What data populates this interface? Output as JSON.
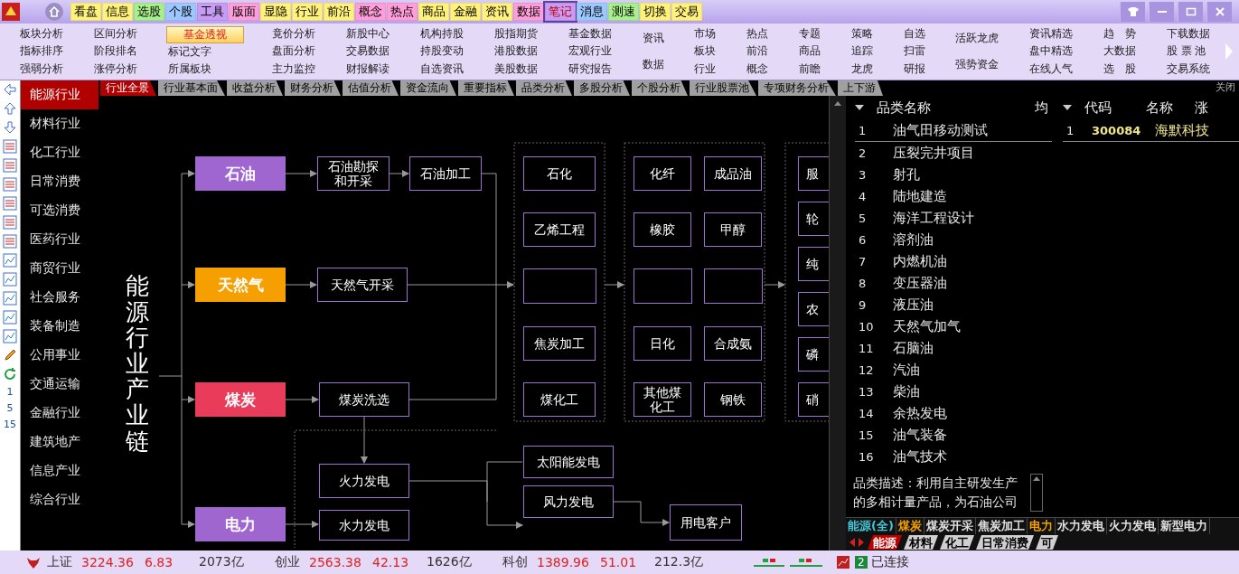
{
  "menu": {
    "items": [
      {
        "label": "看盘",
        "color": "#fff27a",
        "selected": false
      },
      {
        "label": "信息",
        "color": "#fff27a",
        "selected": false
      },
      {
        "label": "选股",
        "color": "#a8f08c",
        "selected": false
      },
      {
        "label": "个股",
        "color": "#9cc8ff",
        "selected": false
      },
      {
        "label": "工具",
        "color": "#c79cf5",
        "selected": false
      },
      {
        "label": "版面",
        "color": "#ff9ed8",
        "selected": false
      },
      {
        "label": "显隐",
        "color": "#fff27a",
        "selected": false
      },
      {
        "label": "行业",
        "color": "#fff27a",
        "selected": false
      },
      {
        "label": "前沿",
        "color": "#fff27a",
        "selected": false
      },
      {
        "label": "概念",
        "color": "#ff9ed8",
        "selected": false
      },
      {
        "label": "热点",
        "color": "#ff9ed8",
        "selected": false
      },
      {
        "label": "商品",
        "color": "#fff27a",
        "selected": false
      },
      {
        "label": "金融",
        "color": "#fff27a",
        "selected": false
      },
      {
        "label": "资讯",
        "color": "#fff27a",
        "selected": false
      },
      {
        "label": "数据",
        "color": "#ff9ed8",
        "selected": false
      },
      {
        "label": "笔记",
        "color": "#c79cf5",
        "selected": true
      },
      {
        "label": "消息",
        "color": "#9cc8ff",
        "selected": false
      },
      {
        "label": "测速",
        "color": "#a8f08c",
        "selected": false
      },
      {
        "label": "切换",
        "color": "#fff27a",
        "selected": false
      },
      {
        "label": "交易",
        "color": "#fff27a",
        "selected": false
      }
    ]
  },
  "submenu": {
    "columns": [
      [
        {
          "label": "板块分析",
          "selected": false
        },
        {
          "label": "指标排序",
          "selected": false
        },
        {
          "label": "强弱分析",
          "selected": false
        }
      ],
      [
        {
          "label": "区间分析",
          "selected": false
        },
        {
          "label": "阶段排名",
          "selected": false
        },
        {
          "label": "涨停分析",
          "selected": false
        }
      ],
      [
        {
          "label": "基金透视",
          "selected": true
        },
        {
          "label": "标记文字",
          "selected": false
        },
        {
          "label": "所属板块",
          "selected": false
        }
      ],
      [
        {
          "label": "竟价分析",
          "selected": false
        },
        {
          "label": "盘面分析",
          "selected": false
        },
        {
          "label": "主力监控",
          "selected": false
        }
      ],
      [
        {
          "label": "新股中心",
          "selected": false
        },
        {
          "label": "交易数据",
          "selected": false
        },
        {
          "label": "财报解读",
          "selected": false
        }
      ],
      [
        {
          "label": "机构持股",
          "selected": false
        },
        {
          "label": "持股变动",
          "selected": false
        },
        {
          "label": "自选资讯",
          "selected": false
        }
      ],
      [
        {
          "label": "股指期货",
          "selected": false
        },
        {
          "label": "港股数据",
          "selected": false
        },
        {
          "label": "美股数据",
          "selected": false
        }
      ],
      [
        {
          "label": "基金数据",
          "selected": false
        },
        {
          "label": "宏观行业",
          "selected": false
        },
        {
          "label": "研究报告",
          "selected": false
        }
      ],
      [
        {
          "label": "资讯",
          "selected": false
        },
        {
          "label": "数据",
          "selected": false
        }
      ],
      [
        {
          "label": "市场",
          "selected": false
        },
        {
          "label": "板块",
          "selected": false
        },
        {
          "label": "行业",
          "selected": false
        }
      ],
      [
        {
          "label": "热点",
          "selected": false
        },
        {
          "label": "前沿",
          "selected": false
        },
        {
          "label": "概念",
          "selected": false
        }
      ],
      [
        {
          "label": "专题",
          "selected": false
        },
        {
          "label": "商品",
          "selected": false
        },
        {
          "label": "前瞻",
          "selected": false
        }
      ],
      [
        {
          "label": "策略",
          "selected": false
        },
        {
          "label": "追踪",
          "selected": false
        },
        {
          "label": "龙虎",
          "selected": false
        }
      ],
      [
        {
          "label": "自选",
          "selected": false
        },
        {
          "label": "扫雷",
          "selected": false
        },
        {
          "label": "研报",
          "selected": false
        }
      ],
      [
        {
          "label": "活跃龙虎",
          "selected": false
        },
        {
          "label": "强势资金",
          "selected": false
        }
      ],
      [
        {
          "label": "资讯精选",
          "selected": false
        },
        {
          "label": "盘中精选",
          "selected": false
        },
        {
          "label": "在线人气",
          "selected": false
        }
      ],
      [
        {
          "label": "趋　势",
          "selected": false
        },
        {
          "label": "大数据",
          "selected": false
        },
        {
          "label": "选　股",
          "selected": false
        }
      ],
      [
        {
          "label": "下载数据",
          "selected": false
        },
        {
          "label": "股 票 池",
          "selected": false
        },
        {
          "label": "交易系统",
          "selected": false
        }
      ]
    ]
  },
  "period_labels": [
    "1",
    "5",
    "15"
  ],
  "sectors": [
    {
      "label": "能源行业",
      "selected": true
    },
    {
      "label": "材料行业",
      "selected": false
    },
    {
      "label": "化工行业",
      "selected": false
    },
    {
      "label": "日常消费",
      "selected": false
    },
    {
      "label": "可选消费",
      "selected": false
    },
    {
      "label": "医药行业",
      "selected": false
    },
    {
      "label": "商贸行业",
      "selected": false
    },
    {
      "label": "社会服务",
      "selected": false
    },
    {
      "label": "装备制造",
      "selected": false
    },
    {
      "label": "公用事业",
      "selected": false
    },
    {
      "label": "交通运输",
      "selected": false
    },
    {
      "label": "金融行业",
      "selected": false
    },
    {
      "label": "建筑地产",
      "selected": false
    },
    {
      "label": "信息产业",
      "selected": false
    },
    {
      "label": "综合行业",
      "selected": false
    }
  ],
  "tabs": [
    {
      "label": "行业全景",
      "selected": true
    },
    {
      "label": "行业基本面",
      "selected": false
    },
    {
      "label": "收益分析",
      "selected": false
    },
    {
      "label": "财务分析",
      "selected": false
    },
    {
      "label": "估值分析",
      "selected": false
    },
    {
      "label": "资金流向",
      "selected": false
    },
    {
      "label": "重要指标",
      "selected": false
    },
    {
      "label": "品类分析",
      "selected": false
    },
    {
      "label": "多股分析",
      "selected": false
    },
    {
      "label": "个股分析",
      "selected": false
    },
    {
      "label": "行业股票池",
      "selected": false
    },
    {
      "label": "专项财务分析",
      "selected": false
    },
    {
      "label": "上下游",
      "selected": false
    }
  ],
  "close_label": "关闭",
  "diagram": {
    "title": "能源行业产业链",
    "sources": [
      {
        "label": "石油",
        "color": "#a066d0"
      },
      {
        "label": "天然气",
        "color": "#f5a000"
      },
      {
        "label": "煤炭",
        "color": "#e83c5a"
      },
      {
        "label": "电力",
        "color": "#a066d0"
      }
    ],
    "steps": [
      {
        "label": "石油勘探和开采"
      },
      {
        "label": "石油加工"
      },
      {
        "label": "天然气开采"
      },
      {
        "label": "煤炭洗选"
      },
      {
        "label": "火力发电"
      },
      {
        "label": "水力发电"
      },
      {
        "label": "石化"
      },
      {
        "label": "乙烯工程"
      },
      {
        "label": "焦炭加工"
      },
      {
        "label": "煤化工"
      },
      {
        "label": "化纤"
      },
      {
        "label": "成品油"
      },
      {
        "label": "橡胶"
      },
      {
        "label": "甲醇"
      },
      {
        "label": "日化"
      },
      {
        "label": "合成氨"
      },
      {
        "label": "其他煤化工"
      },
      {
        "label": "钢铁"
      },
      {
        "label": "服"
      },
      {
        "label": "轮"
      },
      {
        "label": "纯"
      },
      {
        "label": "农"
      },
      {
        "label": "磷"
      },
      {
        "label": "硝"
      },
      {
        "label": "太阳能发电"
      },
      {
        "label": "风力发电"
      },
      {
        "label": "用电客户"
      }
    ]
  },
  "category_table": {
    "columns": [
      "品类名称",
      "均"
    ],
    "rows": [
      {
        "no": "1",
        "name": "油气田移动测试",
        "selected": true
      },
      {
        "no": "2",
        "name": "压裂完井项目",
        "selected": false
      },
      {
        "no": "3",
        "name": "射孔",
        "selected": false
      },
      {
        "no": "4",
        "name": "陆地建造",
        "selected": false
      },
      {
        "no": "5",
        "name": "海洋工程设计",
        "selected": false
      },
      {
        "no": "6",
        "name": "溶剂油",
        "selected": false
      },
      {
        "no": "7",
        "name": "内燃机油",
        "selected": false
      },
      {
        "no": "8",
        "name": "变压器油",
        "selected": false
      },
      {
        "no": "9",
        "name": "液压油",
        "selected": false
      },
      {
        "no": "10",
        "name": "天然气加气",
        "selected": false
      },
      {
        "no": "11",
        "name": "石脑油",
        "selected": false
      },
      {
        "no": "12",
        "name": "汽油",
        "selected": false
      },
      {
        "no": "13",
        "name": "柴油",
        "selected": false
      },
      {
        "no": "14",
        "name": "余热发电",
        "selected": false
      },
      {
        "no": "15",
        "name": "油气装备",
        "selected": false
      },
      {
        "no": "16",
        "name": "油气技术",
        "selected": false
      }
    ]
  },
  "stock_table": {
    "columns": [
      "代码",
      "名称",
      "涨"
    ],
    "rows": [
      {
        "no": "1",
        "code": "300084",
        "name": "海默科技",
        "selected": true
      }
    ]
  },
  "description": "品类描述：利用自主研发生产的多相计量产品，为石油公司",
  "sub_tabs": [
    {
      "label": "能源(全)",
      "color": "#40c8d8"
    },
    {
      "label": "煤炭",
      "color": "#f5a000"
    },
    {
      "label": "煤炭开采",
      "color": "#e0e0e0"
    },
    {
      "label": "焦炭加工",
      "color": "#e0e0e0"
    },
    {
      "label": "电力",
      "color": "#f5a000"
    },
    {
      "label": "水力发电",
      "color": "#e0e0e0"
    },
    {
      "label": "火力发电",
      "color": "#e0e0e0"
    },
    {
      "label": "新型电力",
      "color": "#e0e0e0"
    }
  ],
  "sector_tabs": [
    {
      "label": "能源",
      "selected": true
    },
    {
      "label": "材料",
      "selected": false
    },
    {
      "label": "化工",
      "selected": false
    },
    {
      "label": "日常消费",
      "selected": false
    },
    {
      "label": "可",
      "selected": false
    }
  ],
  "status_bar": {
    "indices": [
      {
        "name": "上证",
        "value": "3224.36",
        "change": "6.83",
        "amount": "2073亿"
      },
      {
        "name": "创业",
        "value": "2563.38",
        "change": "42.13",
        "amount": "1626亿"
      },
      {
        "name": "科创",
        "value": "1389.96",
        "change": "51.01",
        "amount": "212.3亿"
      }
    ],
    "connections": "2",
    "connection_status": "已连接"
  }
}
